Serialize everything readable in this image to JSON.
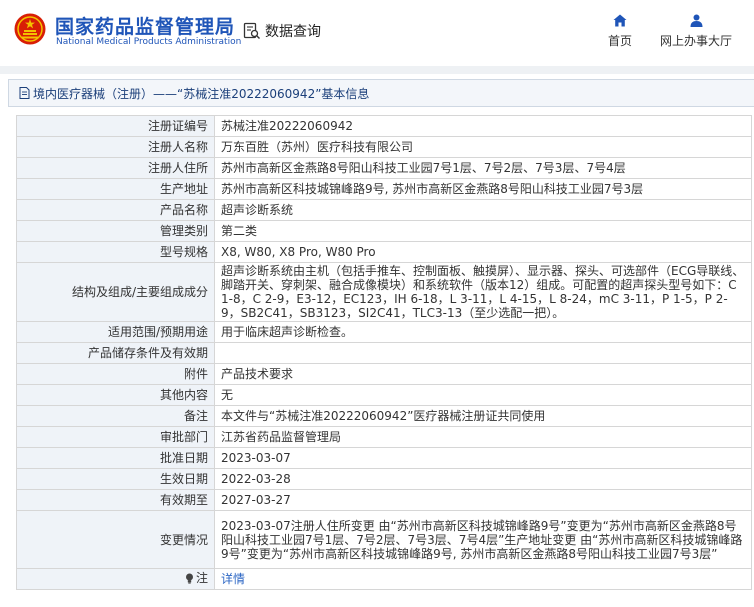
{
  "header": {
    "brand_cn": "国家药品监督管理局",
    "brand_en": "National Medical Products Administration",
    "search_label": "数据查询",
    "nav": [
      {
        "label": "首页",
        "icon": "home-icon"
      },
      {
        "label": "网上办事大厅",
        "icon": "user-icon"
      }
    ],
    "brand_color": "#1f55b8"
  },
  "titlebar": {
    "text": "境内医疗器械（注册）——“苏械注准20222060942”基本信息"
  },
  "rows": [
    {
      "key": "注册证编号",
      "value": "苏械注准20222060942"
    },
    {
      "key": "注册人名称",
      "value": "万东百胜（苏州）医疗科技有限公司"
    },
    {
      "key": "注册人住所",
      "value": "苏州市高新区金燕路8号阳山科技工业园7号1层、7号2层、7号3层、7号4层"
    },
    {
      "key": "生产地址",
      "value": "苏州市高新区科技城锦峰路9号, 苏州市高新区金燕路8号阳山科技工业园7号3层"
    },
    {
      "key": "产品名称",
      "value": "超声诊断系统"
    },
    {
      "key": "管理类别",
      "value": "第二类"
    },
    {
      "key": "型号规格",
      "value": "X8, W80, X8 Pro, W80 Pro"
    },
    {
      "key": "结构及组成/主要组成成分",
      "value": "超声诊断系统由主机（包括手推车、控制面板、触摸屏）、显示器、探头、可选部件（ECG导联线、脚踏开关、穿刺架、融合成像模块）和系统软件（版本12）组成。可配置的超声探头型号如下：C 1-8，C 2-9，E3-12，EC123，IH 6-18，L 3-11，L 4-15，L 8-24，mC 3-11，P 1-5，P 2-9，SB2C41，SB3123，SI2C41，TLC3-13（至少选配一把）。"
    },
    {
      "key": "适用范围/预期用途",
      "value": "用于临床超声诊断检查。"
    },
    {
      "key": "产品储存条件及有效期",
      "value": ""
    },
    {
      "key": "附件",
      "value": "产品技术要求"
    },
    {
      "key": "其他内容",
      "value": "无"
    },
    {
      "key": "备注",
      "value": "本文件与“苏械注准20222060942”医疗器械注册证共同使用"
    },
    {
      "key": "审批部门",
      "value": "江苏省药品监督管理局"
    },
    {
      "key": "批准日期",
      "value": "2023-03-07"
    },
    {
      "key": "生效日期",
      "value": "2022-03-28"
    },
    {
      "key": "有效期至",
      "value": "2027-03-27"
    },
    {
      "key": "变更情况",
      "value": "2023-03-07注册人住所变更 由“苏州市高新区科技城锦峰路9号”变更为“苏州市高新区金燕路8号阳山科技工业园7号1层、7号2层、7号3层、7号4层”生产地址变更 由“苏州市高新区科技城锦峰路9号”变更为“苏州市高新区科技城锦峰路9号, 苏州市高新区金燕路8号阳山科技工业园7号3层”"
    }
  ],
  "note_row": {
    "key": "注",
    "link_text": "详情",
    "icon": "lightbulb-icon"
  }
}
